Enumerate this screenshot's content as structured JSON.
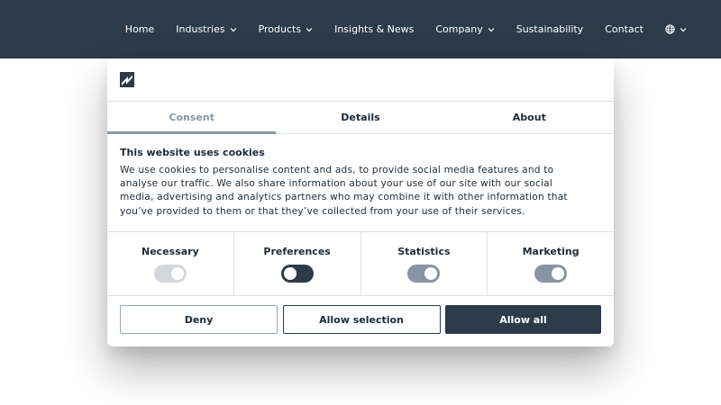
{
  "nav": {
    "items": [
      {
        "label": "Home",
        "dropdown": false
      },
      {
        "label": "Industries",
        "dropdown": true
      },
      {
        "label": "Products",
        "dropdown": true
      },
      {
        "label": "Insights & News",
        "dropdown": false
      },
      {
        "label": "Company",
        "dropdown": true
      },
      {
        "label": "Sustainability",
        "dropdown": false
      },
      {
        "label": "Contact",
        "dropdown": false
      }
    ],
    "language_icon": "globe-icon"
  },
  "dialog": {
    "logo_icon": "brand-logo",
    "tabs": [
      "Consent",
      "Details",
      "About"
    ],
    "active_tab": "Consent",
    "heading": "This website uses cookies",
    "body": "We use cookies to personalise content and ads, to provide social media features and to analyse our traffic. We also share information about your use of our site with our social media, advertising and analytics partners who may combine it with other information that you’ve provided to them or that they’ve collected from your use of their services.",
    "toggles": [
      {
        "label": "Necessary",
        "on": true,
        "disabled": true
      },
      {
        "label": "Preferences",
        "on": false,
        "disabled": false
      },
      {
        "label": "Statistics",
        "on": true,
        "disabled": false
      },
      {
        "label": "Marketing",
        "on": true,
        "disabled": false
      }
    ],
    "buttons": {
      "deny": "Deny",
      "allow_selection": "Allow selection",
      "allow_all": "Allow all"
    }
  },
  "colors": {
    "header_bg": "#2c3a4a",
    "accent": "#8a98a8",
    "toggle_on": "#8795a5",
    "toggle_off": "#2c3a4a",
    "toggle_disabled": "#d4d8dc"
  }
}
